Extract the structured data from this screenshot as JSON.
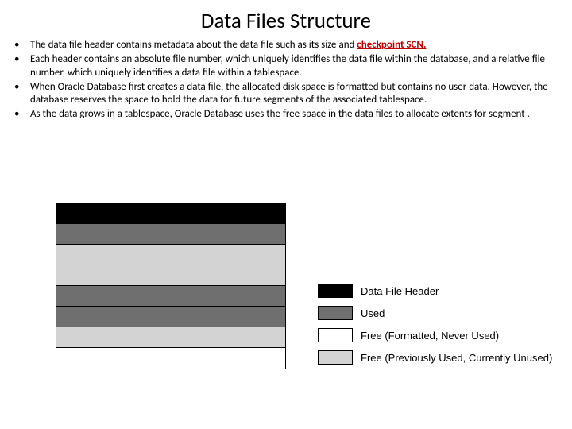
{
  "title": "Data Files Structure",
  "bullets": [
    {
      "pre": "The data file header contains metadata about the data file such as its size and ",
      "hl": "checkpoint SCN.",
      "post": ""
    },
    {
      "pre": "Each header contains an absolute file number, which uniquely identifies the data file within the database, and a relative file number, which uniquely identifies a data file within a tablespace.",
      "hl": "",
      "post": ""
    },
    {
      "pre": "When Oracle Database first creates a data file, the allocated disk space is formatted but contains no user data. However, the database reserves the space to hold the data for future segments of the associated tablespace.",
      "hl": "",
      "post": ""
    },
    {
      "pre": "As the data grows in a tablespace, Oracle Database uses the free space in the data files to allocate extents for  segment .",
      "hl": "",
      "post": ""
    }
  ],
  "stack_rows": [
    "c-black",
    "c-used",
    "c-free1",
    "c-free1",
    "c-used",
    "c-used",
    "c-free1",
    "c-free2"
  ],
  "legend": [
    {
      "cls": "c-black",
      "label": "Data File Header"
    },
    {
      "cls": "c-used",
      "label": "Used"
    },
    {
      "cls": "c-free2",
      "label": "Free (Formatted, Never Used)"
    },
    {
      "cls": "c-free1",
      "label": "Free (Previously Used, Currently Unused)"
    }
  ]
}
